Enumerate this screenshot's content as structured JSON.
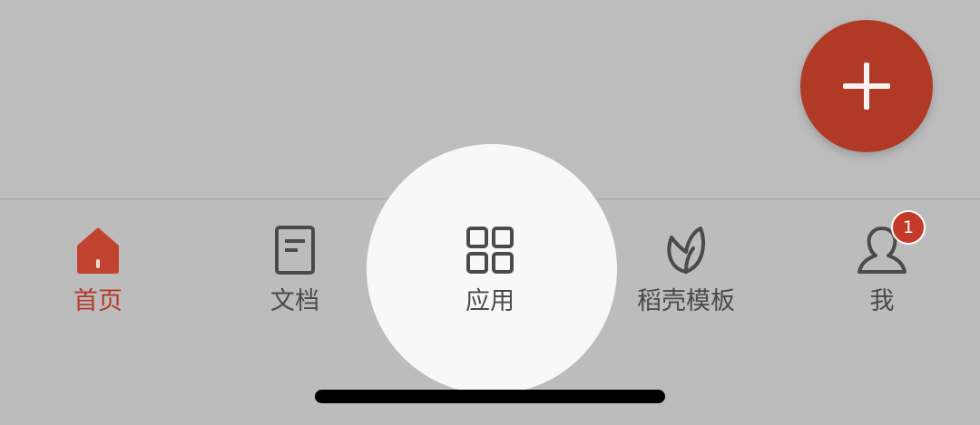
{
  "fab": {
    "icon": "plus-icon",
    "color": "#b03a26"
  },
  "tabs": [
    {
      "id": "home",
      "label": "首页",
      "icon": "home-icon",
      "active": true
    },
    {
      "id": "docs",
      "label": "文档",
      "icon": "document-icon",
      "active": false
    },
    {
      "id": "apps",
      "label": "应用",
      "icon": "grid-icon",
      "active": false
    },
    {
      "id": "templates",
      "label": "稻壳模板",
      "icon": "leaf-icon",
      "active": false
    },
    {
      "id": "me",
      "label": "我",
      "icon": "user-icon",
      "active": false,
      "badge": "1"
    }
  ],
  "colors": {
    "accent": "#b53a27",
    "inactive": "#4a4a4a",
    "badge": "#c4392a",
    "background": "#bdbdbd"
  }
}
